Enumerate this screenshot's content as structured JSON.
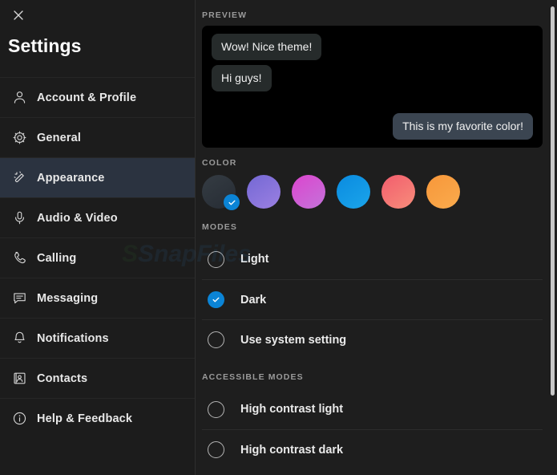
{
  "window": {
    "title": "Settings",
    "close_icon": "close-icon"
  },
  "sidebar": {
    "items": [
      {
        "label": "Account & Profile",
        "icon": "person-icon",
        "active": false
      },
      {
        "label": "General",
        "icon": "gear-icon",
        "active": false
      },
      {
        "label": "Appearance",
        "icon": "magic-wand-icon",
        "active": true
      },
      {
        "label": "Audio & Video",
        "icon": "microphone-icon",
        "active": false
      },
      {
        "label": "Calling",
        "icon": "phone-icon",
        "active": false
      },
      {
        "label": "Messaging",
        "icon": "chat-bubble-icon",
        "active": false
      },
      {
        "label": "Notifications",
        "icon": "bell-icon",
        "active": false
      },
      {
        "label": "Contacts",
        "icon": "contact-card-icon",
        "active": false
      },
      {
        "label": "Help & Feedback",
        "icon": "info-circle-icon",
        "active": false
      }
    ]
  },
  "main": {
    "preview": {
      "heading": "PREVIEW",
      "messages": [
        {
          "text": "Wow! Nice theme!",
          "direction": "in"
        },
        {
          "text": "Hi guys!",
          "direction": "in"
        },
        {
          "text": "This is my favorite color!",
          "direction": "out"
        }
      ],
      "background": "#000000",
      "bubble_in_color": "#262b2b",
      "bubble_out_color": "#3b4551"
    },
    "color": {
      "heading": "COLOR",
      "selected_index": 0,
      "swatches": [
        {
          "name": "slate-gray",
          "from": "#32393f",
          "to": "#272d35"
        },
        {
          "name": "purple",
          "from": "#7b6bd6",
          "to": "#9a7ee0"
        },
        {
          "name": "magenta",
          "from": "#d94ad0",
          "to": "#c96fd8"
        },
        {
          "name": "blue",
          "from": "#0b8fe0",
          "to": "#1aa0e8"
        },
        {
          "name": "coral",
          "from": "#f2626f",
          "to": "#f58a7a"
        },
        {
          "name": "orange",
          "from": "#f79a3a",
          "to": "#f9a94b"
        }
      ],
      "check_badge_color": "#0b84d6"
    },
    "modes": {
      "heading": "MODES",
      "selected": "Dark",
      "options": [
        {
          "label": "Light",
          "selected": false
        },
        {
          "label": "Dark",
          "selected": true
        },
        {
          "label": "Use system setting",
          "selected": false
        }
      ]
    },
    "accessible_modes": {
      "heading": "ACCESSIBLE MODES",
      "options": [
        {
          "label": "High contrast light",
          "selected": false
        },
        {
          "label": "High contrast dark",
          "selected": false
        }
      ]
    },
    "accent_color": "#0b84d6"
  },
  "watermark": {
    "part1": "S",
    "part2": "SnapFiles"
  }
}
